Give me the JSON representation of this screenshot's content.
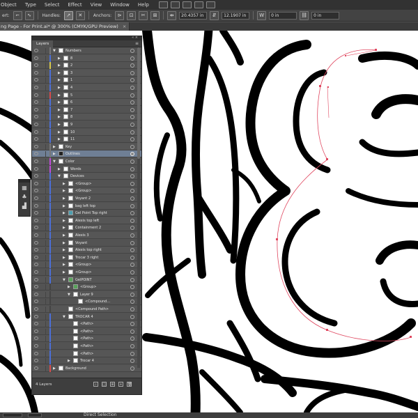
{
  "menubar": {
    "items": [
      "Object",
      "Type",
      "Select",
      "Effect",
      "View",
      "Window",
      "Help"
    ],
    "icons": [
      "bridge-icon",
      "stock-icon",
      "arrange-icon",
      "gpu-icon",
      "brush-icon"
    ]
  },
  "controlbar": {
    "convert_label": "ert:",
    "handles_label": "Handles:",
    "anchors_label": "Anchors:",
    "x_value": "20.4357 in",
    "y_value": "12.1907 in",
    "w_value": "0 in",
    "h_value": "0 in"
  },
  "document": {
    "tab_title": "ng Page - For Print.ai* @ 300% (CMYK/GPU Preview)",
    "close": "×"
  },
  "layers_panel": {
    "tab_label": "Layers",
    "menu_glyph": "≡",
    "close_glyph": "«  ×",
    "footer_count": "4 Layers",
    "rows": [
      {
        "label": "Numbers",
        "indent": 0,
        "arrow": "down",
        "color": "#777777",
        "thumb": "plain"
      },
      {
        "label": "8",
        "indent": 1,
        "arrow": "right",
        "color": "#4b6fd8",
        "thumb": "plain"
      },
      {
        "label": "2",
        "indent": 1,
        "arrow": "right",
        "color": "#d8c84b",
        "thumb": "plain"
      },
      {
        "label": "3",
        "indent": 1,
        "arrow": "right",
        "color": "#4b6fd8",
        "thumb": "plain"
      },
      {
        "label": "1",
        "indent": 1,
        "arrow": "right",
        "color": "#4b6fd8",
        "thumb": "plain"
      },
      {
        "label": "4",
        "indent": 1,
        "arrow": "right",
        "color": "#4b6fd8",
        "thumb": "plain"
      },
      {
        "label": "5",
        "indent": 1,
        "arrow": "right",
        "color": "#d84b4b",
        "thumb": "plain"
      },
      {
        "label": "6",
        "indent": 1,
        "arrow": "right",
        "color": "#4b6fd8",
        "thumb": "plain"
      },
      {
        "label": "7",
        "indent": 1,
        "arrow": "right",
        "color": "#4b6fd8",
        "thumb": "plain"
      },
      {
        "label": "8",
        "indent": 1,
        "arrow": "right",
        "color": "#4b6fd8",
        "thumb": "plain"
      },
      {
        "label": "9",
        "indent": 1,
        "arrow": "right",
        "color": "#4b6fd8",
        "thumb": "plain"
      },
      {
        "label": "10",
        "indent": 1,
        "arrow": "right",
        "color": "#4b6fd8",
        "thumb": "plain"
      },
      {
        "label": "11",
        "indent": 1,
        "arrow": "right",
        "color": "#4b6fd8",
        "thumb": "plain"
      },
      {
        "label": "Key",
        "indent": 0,
        "arrow": "right",
        "color": "#777777",
        "thumb": "plain"
      },
      {
        "label": "Outlines",
        "indent": 0,
        "arrow": "right",
        "color": "#777777",
        "thumb": "dark",
        "selected": true
      },
      {
        "label": "Color",
        "indent": 0,
        "arrow": "down",
        "color": "#c04bd8",
        "thumb": "plain"
      },
      {
        "label": "Words",
        "indent": 1,
        "arrow": "right",
        "color": "#c04bd8",
        "thumb": "plain"
      },
      {
        "label": "Devices",
        "indent": 1,
        "arrow": "down",
        "color": "#4b6fd8",
        "thumb": "plain"
      },
      {
        "label": "<Group>",
        "indent": 2,
        "arrow": "right",
        "color": "#4b6fd8",
        "thumb": "plain"
      },
      {
        "label": "<Group>",
        "indent": 2,
        "arrow": "right",
        "color": "#4b6fd8",
        "thumb": "plain"
      },
      {
        "label": "Voyant 2",
        "indent": 2,
        "arrow": "right",
        "color": "#4b6fd8",
        "thumb": "plain"
      },
      {
        "label": "bag left top",
        "indent": 2,
        "arrow": "right",
        "color": "#4b6fd8",
        "thumb": "plain"
      },
      {
        "label": "Gel Point Top right",
        "indent": 2,
        "arrow": "right",
        "color": "#4b6fd8",
        "thumb": "teal"
      },
      {
        "label": "Alexis top left",
        "indent": 2,
        "arrow": "right",
        "color": "#4b6fd8",
        "thumb": "plain"
      },
      {
        "label": "Containment 2",
        "indent": 2,
        "arrow": "right",
        "color": "#4b6fd8",
        "thumb": "plain"
      },
      {
        "label": "Alexis 3",
        "indent": 2,
        "arrow": "right",
        "color": "#4b6fd8",
        "thumb": "plain"
      },
      {
        "label": "Voyant",
        "indent": 2,
        "arrow": "right",
        "color": "#4b6fd8",
        "thumb": "plain"
      },
      {
        "label": "Alexis top right",
        "indent": 2,
        "arrow": "right",
        "color": "#4b6fd8",
        "thumb": "plain"
      },
      {
        "label": "Trocar 3 right",
        "indent": 2,
        "arrow": "right",
        "color": "#4b6fd8",
        "thumb": "plain"
      },
      {
        "label": "<Group>",
        "indent": 2,
        "arrow": "right",
        "color": "#4b6fd8",
        "thumb": "plain"
      },
      {
        "label": "<Group>",
        "indent": 2,
        "arrow": "right",
        "color": "#4b6fd8",
        "thumb": "plain"
      },
      {
        "label": "GelPOINT",
        "indent": 2,
        "arrow": "down",
        "color": "#4b6fd8",
        "thumb": "green"
      },
      {
        "label": "<Group>",
        "indent": 3,
        "arrow": "right",
        "color": "#444444",
        "thumb": "green"
      },
      {
        "label": "Layer 9",
        "indent": 3,
        "arrow": "down",
        "color": "#444444",
        "thumb": "plain"
      },
      {
        "label": "<Compound...",
        "indent": 4,
        "arrow": "",
        "color": "#444444",
        "thumb": "plain"
      },
      {
        "label": "<Compound Path>",
        "indent": 2,
        "arrow": "",
        "color": "#444444",
        "thumb": "plain"
      },
      {
        "label": "TROCAR 4",
        "indent": 2,
        "arrow": "down",
        "color": "#4b6fd8",
        "thumb": "plain"
      },
      {
        "label": "<Path>",
        "indent": 3,
        "arrow": "",
        "color": "#4b6fd8",
        "thumb": "plain"
      },
      {
        "label": "<Path>",
        "indent": 3,
        "arrow": "",
        "color": "#4b6fd8",
        "thumb": "plain"
      },
      {
        "label": "<Path>",
        "indent": 3,
        "arrow": "",
        "color": "#4b6fd8",
        "thumb": "plain"
      },
      {
        "label": "<Path>",
        "indent": 3,
        "arrow": "",
        "color": "#4b6fd8",
        "thumb": "plain"
      },
      {
        "label": "<Path>",
        "indent": 3,
        "arrow": "",
        "color": "#4b6fd8",
        "thumb": "plain"
      },
      {
        "label": "Trocar 4",
        "indent": 3,
        "arrow": "right",
        "color": "#4b6fd8",
        "thumb": "plain"
      },
      {
        "label": "Background",
        "indent": 0,
        "arrow": "right",
        "color": "#d84b4b",
        "thumb": "plain"
      }
    ]
  },
  "statusbar": {
    "zoom_field": "",
    "tool_label": "Direct Selection"
  },
  "colors": {
    "selection_path": "#e04860",
    "selected_row": "#6f7f95"
  }
}
